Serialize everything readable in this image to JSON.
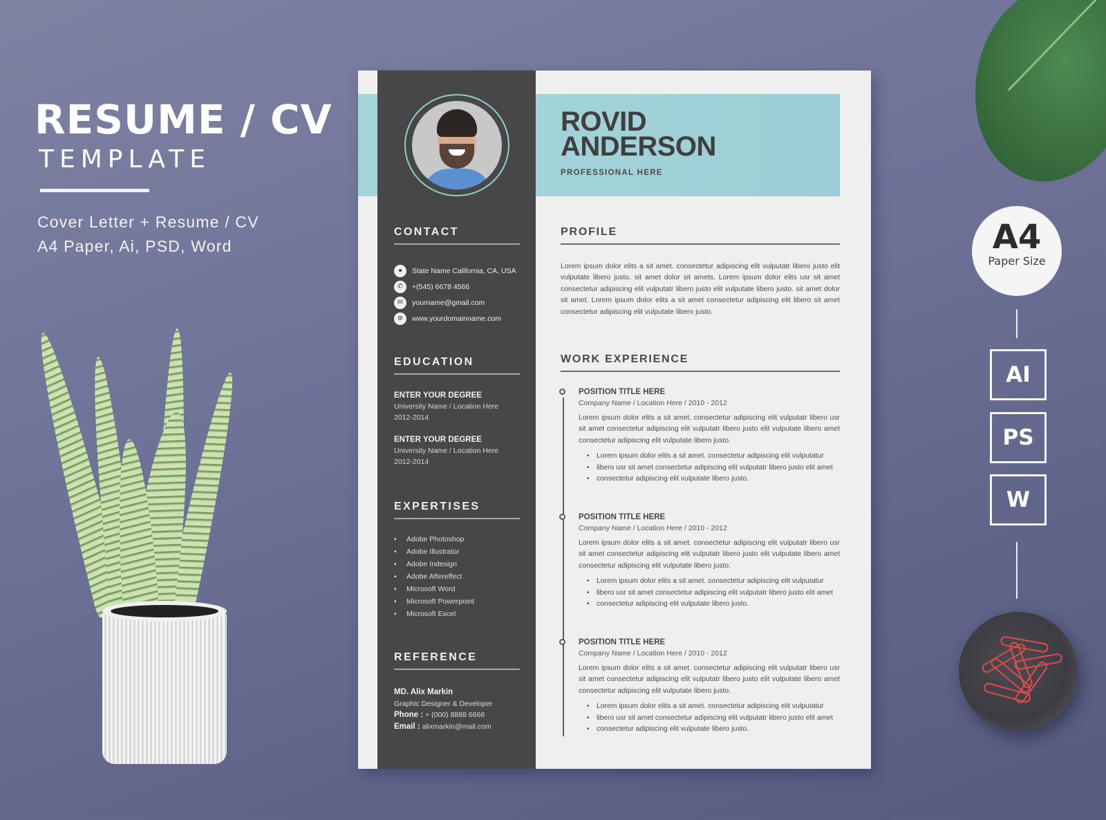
{
  "promo": {
    "title": "RESUME / CV",
    "subtitle": "TEMPLATE",
    "features": [
      "Cover Letter + Resume / CV",
      "A4 Paper, Ai, PSD, Word"
    ]
  },
  "resume": {
    "name_line1": "ROVID",
    "name_line2": "ANDERSON",
    "role": "PROFESSIONAL HERE",
    "accent_color": "#a3d4da",
    "sidebar_color": "#474747",
    "contact": {
      "heading": "CONTACT",
      "items": [
        {
          "icon": "location-pin-icon",
          "glyph": "⬤",
          "text": "State Name California, CA, USA"
        },
        {
          "icon": "phone-icon",
          "glyph": "✆",
          "text": "+(545) 6678 4566"
        },
        {
          "icon": "mail-icon",
          "glyph": "✉",
          "text": "yourname@gmail.com"
        },
        {
          "icon": "globe-icon",
          "glyph": "⊕",
          "text": "www.yourdomainname.com"
        }
      ]
    },
    "education": {
      "heading": "EDUCATION",
      "items": [
        {
          "degree": "ENTER YOUR DEGREE",
          "school": "University Name / Location Here",
          "years": "2012-2014"
        },
        {
          "degree": "ENTER YOUR DEGREE",
          "school": "University Name / Location Here",
          "years": "2012-2014"
        }
      ]
    },
    "expertises": {
      "heading": "EXPERTISES",
      "items": [
        "Adobe Photoshop",
        "Adobe Illustrator",
        "Adobe Indesign",
        "Adobe Aftereffect",
        "Microsoft Word",
        "Microsoft Powerpoint",
        "Microsoft Excel"
      ]
    },
    "reference": {
      "heading": "REFERENCE",
      "name": "MD. Alix Markin",
      "title": "Graphic Designer & Developer",
      "phone_label": "Phone :",
      "phone": " + (000) 8888 6666",
      "email_label": "Email :",
      "email": " alixmarkin@mail.com"
    },
    "profile": {
      "heading": "PROFILE",
      "text": "Lorem ipsum dolor elits a sit amet. consectetur adipiscing elit vulputatr libero justo elit vulputate libero justo. sit amet dolor sit amets. Lorem ipsum dolor elits usr sit amet consectetur adipiscing elit vulputatr libero justo elit vulputate libero justo. sit amet dolor sit amet. Lorem ipsum dolor elits a sit amet consectetur adipiscing elit libero sit amet consectetur adipiscing elit vulputate libero justo."
    },
    "work": {
      "heading": "WORK EXPERIENCE",
      "jobs": [
        {
          "title": "POSITION TITLE HERE",
          "company": "Company Name / Location Here / 2010 - 2012",
          "desc": "Lorem ipsum dolor elits a sit amet. consectetur adipiscing elit vulputatr libero usr sit amet consectetur adipiscing elit vulputatr libero justo elit vulputate libero amet consectetur adipiscing elit vulputate libero justo.",
          "bullets": [
            "Lorem ipsum dolor elits a sit amet. consectetur adipiscing elit vulputatur",
            "libero usr sit amet consectetur adipiscing elit vulputatr libero justo elit amet",
            "consectetur adipiscing elit vulputate libero justo."
          ]
        },
        {
          "title": "POSITION TITLE HERE",
          "company": "Company Name / Location Here / 2010 - 2012",
          "desc": "Lorem ipsum dolor elits a sit amet. consectetur adipiscing elit vulputatr libero usr sit amet consectetur adipiscing elit vulputatr libero justo elit vulputate libero amet consectetur adipiscing elit vulputate libero justo.",
          "bullets": [
            "Lorem ipsum dolor elits a sit amet. consectetur adipiscing elit vulputatur",
            "libero usr sit amet consectetur adipiscing elit vulputatr libero justo elit amet",
            "consectetur adipiscing elit vulputate libero justo."
          ]
        },
        {
          "title": "POSITION TITLE HERE",
          "company": "Company Name / Location Here / 2010 - 2012",
          "desc": "Lorem ipsum dolor elits a sit amet. consectetur adipiscing elit vulputatr libero usr sit amet consectetur adipiscing elit vulputatr libero justo elit vulputate libero amet consectetur adipiscing elit vulputate libero justo.",
          "bullets": [
            "Lorem ipsum dolor elits a sit amet. consectetur adipiscing elit vulputatur",
            "libero usr sit amet consectetur adipiscing elit vulputatr libero justo elit amet",
            "consectetur adipiscing elit vulputate libero justo."
          ]
        }
      ]
    }
  },
  "badge": {
    "big": "A4",
    "small": "Paper Size"
  },
  "formats": [
    "AI",
    "PS",
    "W"
  ]
}
